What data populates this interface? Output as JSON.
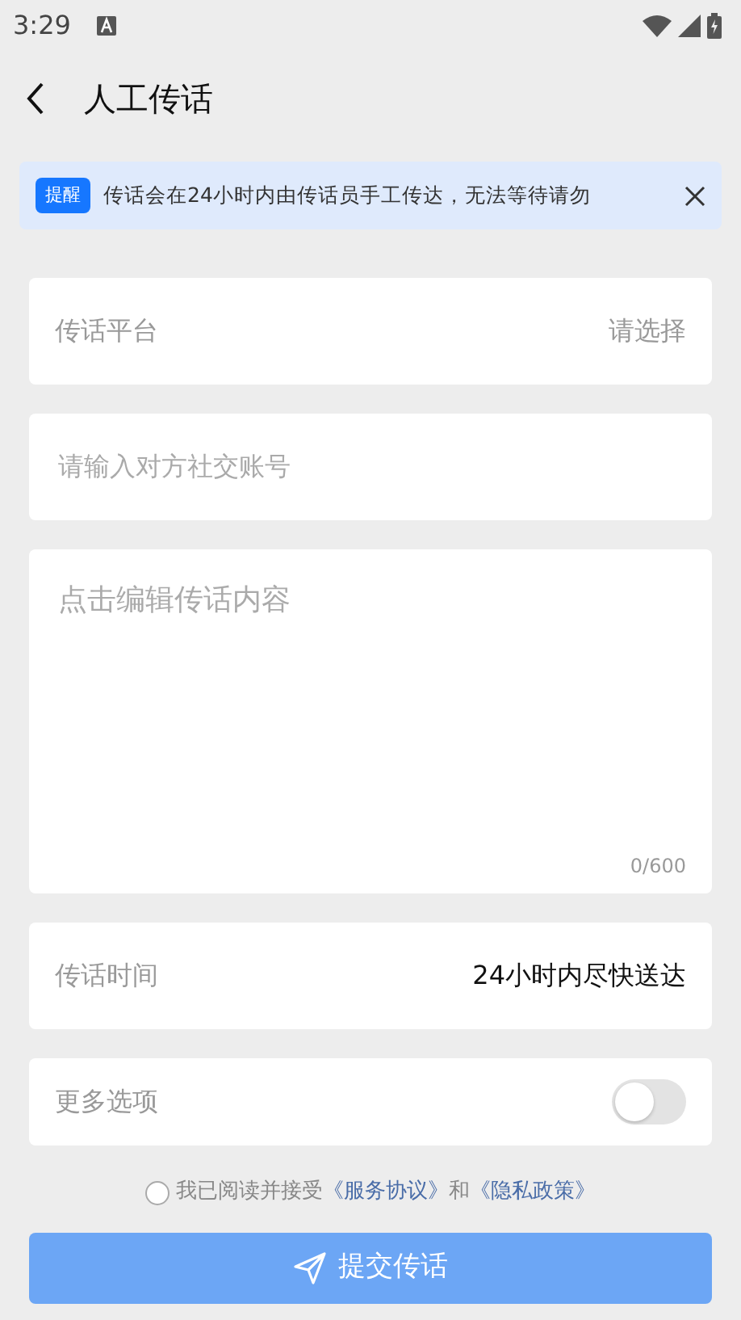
{
  "status_bar": {
    "time": "3:29"
  },
  "header": {
    "title": "人工传话"
  },
  "notice": {
    "tag": "提醒",
    "text": "传话会在24小时内由传话员手工传达，无法等待请勿"
  },
  "platform": {
    "label": "传话平台",
    "value": "请选择"
  },
  "account": {
    "placeholder": "请输入对方社交账号"
  },
  "content": {
    "placeholder": "点击编辑传话内容",
    "counter": "0/600"
  },
  "time_row": {
    "label": "传话时间",
    "value": "24小时内尽快送达"
  },
  "more_options": {
    "label": "更多选项",
    "on": false
  },
  "agreement": {
    "checked": false,
    "prefix": "我已阅读并接受",
    "link1": "《服务协议》",
    "middle": "和",
    "link2": "《隐私政策》"
  },
  "submit": {
    "label": "提交传话"
  }
}
